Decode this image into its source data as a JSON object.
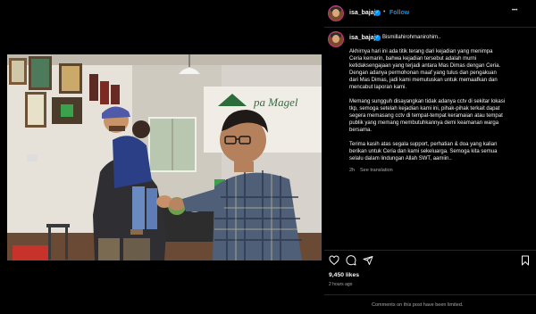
{
  "post": {
    "username": "isa_bajaj",
    "follow_label": "Follow",
    "separator": "•",
    "more_label": "•••",
    "caption_username": "isa_bajaj",
    "caption_first": "Bismillahirohmanirohim..",
    "caption_lines": [
      "Akhirnya hari ini ada titik terang dari kejadian yang menimpa",
      "Ceria kemarin, bahwa kejadian tersebut adalah murni",
      "ketidaksengajaan yang terjadi antara Mas Dimas dengan Ceria.",
      "Dengan adanya permohonan maaf yang tulus dan pengakuan",
      "dari Mas Dimas, jadi kami memutuskan untuk memaafkan dan",
      "mencabut laporan kami.",
      "",
      "Memang sungguh disayangkan tidak adanya cctv di sekitar lokasi",
      "tkp, semoga setelah kejadian kami ini, pihak-pihak terkait dapat",
      "segera memasang cctv di tempat-tempat keramaian atau tempat",
      "publik yang memang membutuhkannya demi keamanan warga",
      "bersama.",
      "",
      "Terima kasih atas segala support, perhatian & doa yang kalian",
      "berikan untuk Ceria dan kami sekeluarga. Semoga kita semua",
      "selalu dalam lindungan Allah SWT, aamiin.."
    ],
    "caption_time": "2h",
    "caption_reply": "See translation",
    "likes": "9,450 likes",
    "time_ago": "2 hours ago",
    "comments_limited": "Comments on this post have been limited."
  },
  "photo": {
    "sign_text": "pa Magel"
  },
  "icons": {
    "like": "heart-icon",
    "comment": "comment-icon",
    "share": "share-icon",
    "save": "bookmark-icon"
  }
}
